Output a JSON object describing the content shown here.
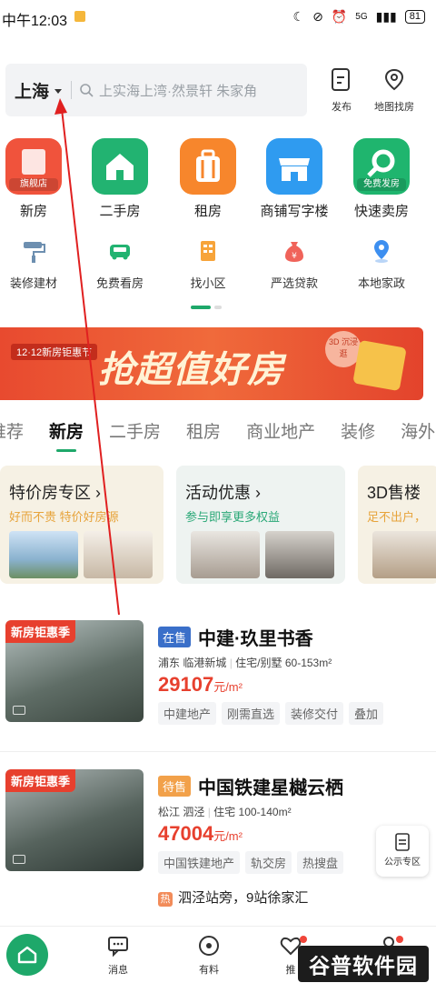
{
  "status_bar": {
    "time": "中午12:03",
    "battery": "81",
    "signal": "5G"
  },
  "header": {
    "city": "上海",
    "search_placeholder": "上实海上湾·然景轩 朱家角",
    "publish_label": "发布",
    "map_label": "地图找房"
  },
  "main_tiles": [
    {
      "label": "新房",
      "tag": "旗舰店",
      "color": "#f0533c"
    },
    {
      "label": "二手房",
      "color": "#22b371"
    },
    {
      "label": "租房",
      "color": "#f7862c"
    },
    {
      "label": "商铺写字楼",
      "color": "#2f9bf0"
    },
    {
      "label": "快速卖房",
      "tag": "免费发房",
      "color": "#1fb56e"
    }
  ],
  "small_tiles": [
    {
      "label": "装修建材",
      "icon": "paint-roller-icon"
    },
    {
      "label": "免费看房",
      "icon": "car-icon"
    },
    {
      "label": "找小区",
      "icon": "building-icon"
    },
    {
      "label": "严选贷款",
      "icon": "money-bag-icon"
    },
    {
      "label": "本地家政",
      "icon": "location-pin-icon"
    }
  ],
  "banner": {
    "small_text": "12·12新房钜惠节",
    "headline": "抢超值好房",
    "badge": "3D 沉浸逛"
  },
  "tabs": [
    "推荐",
    "新房",
    "二手房",
    "租房",
    "商业地产",
    "装修",
    "海外"
  ],
  "active_tab": "新房",
  "promo_cards": [
    {
      "title": "特价房专区 ›",
      "subtitle": "好而不贵 特价好房源",
      "subtitle_color": "#e7a33a"
    },
    {
      "title": "活动优惠 ›",
      "subtitle": "参与即享更多权益",
      "subtitle_color": "#2aa877"
    },
    {
      "title": "3D售楼",
      "subtitle": "足不出户，",
      "subtitle_color": "#e7a33a"
    }
  ],
  "listings": [
    {
      "ribbon": "新房钜惠季",
      "status": "在售",
      "status_color": "#3a6fc9",
      "name": "中建·玖里书香",
      "district": "浦东",
      "area": "临港新城",
      "type": "住宅/别墅",
      "size": "60-153m²",
      "price": "29107",
      "unit": "元/m²",
      "tags": [
        "中建地产",
        "刚需直选",
        "装修交付",
        "叠加"
      ]
    },
    {
      "ribbon": "新房钜惠季",
      "status": "待售",
      "status_color": "#f2a14a",
      "name": "中国铁建星樾云栖",
      "district": "松江",
      "area": "泗泾",
      "type": "住宅",
      "size": "100-140m²",
      "price": "47004",
      "unit": "元/m²",
      "tags": [
        "中国铁建地产",
        "轨交房",
        "热搜盘"
      ],
      "hot_badge": "热",
      "hot_text": "泗泾站旁，9站徐家汇"
    }
  ],
  "float_button": "公示专区",
  "bottom_nav": [
    "消息",
    "有料",
    "推",
    "我"
  ],
  "watermark": "谷普软件园",
  "accent_color": "#1ea86a"
}
